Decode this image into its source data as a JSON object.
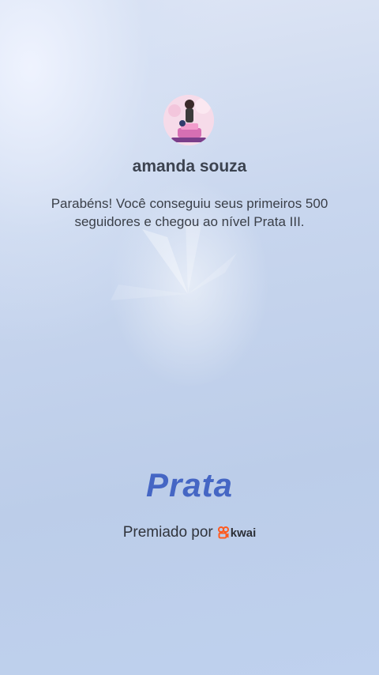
{
  "profile": {
    "username": "amanda souza",
    "avatar_icon": "avatar-icon"
  },
  "message": {
    "text": "Parabéns! Você conseguiu seus primeiros 500 seguidores e chegou ao nível Prata III."
  },
  "tier": {
    "label": "Prata",
    "color": "#4566c4"
  },
  "awarded": {
    "label": "Premiado por",
    "brand": "kwai",
    "brand_icon": "kwai-logo-icon",
    "brand_color": "#ff5a1f"
  }
}
